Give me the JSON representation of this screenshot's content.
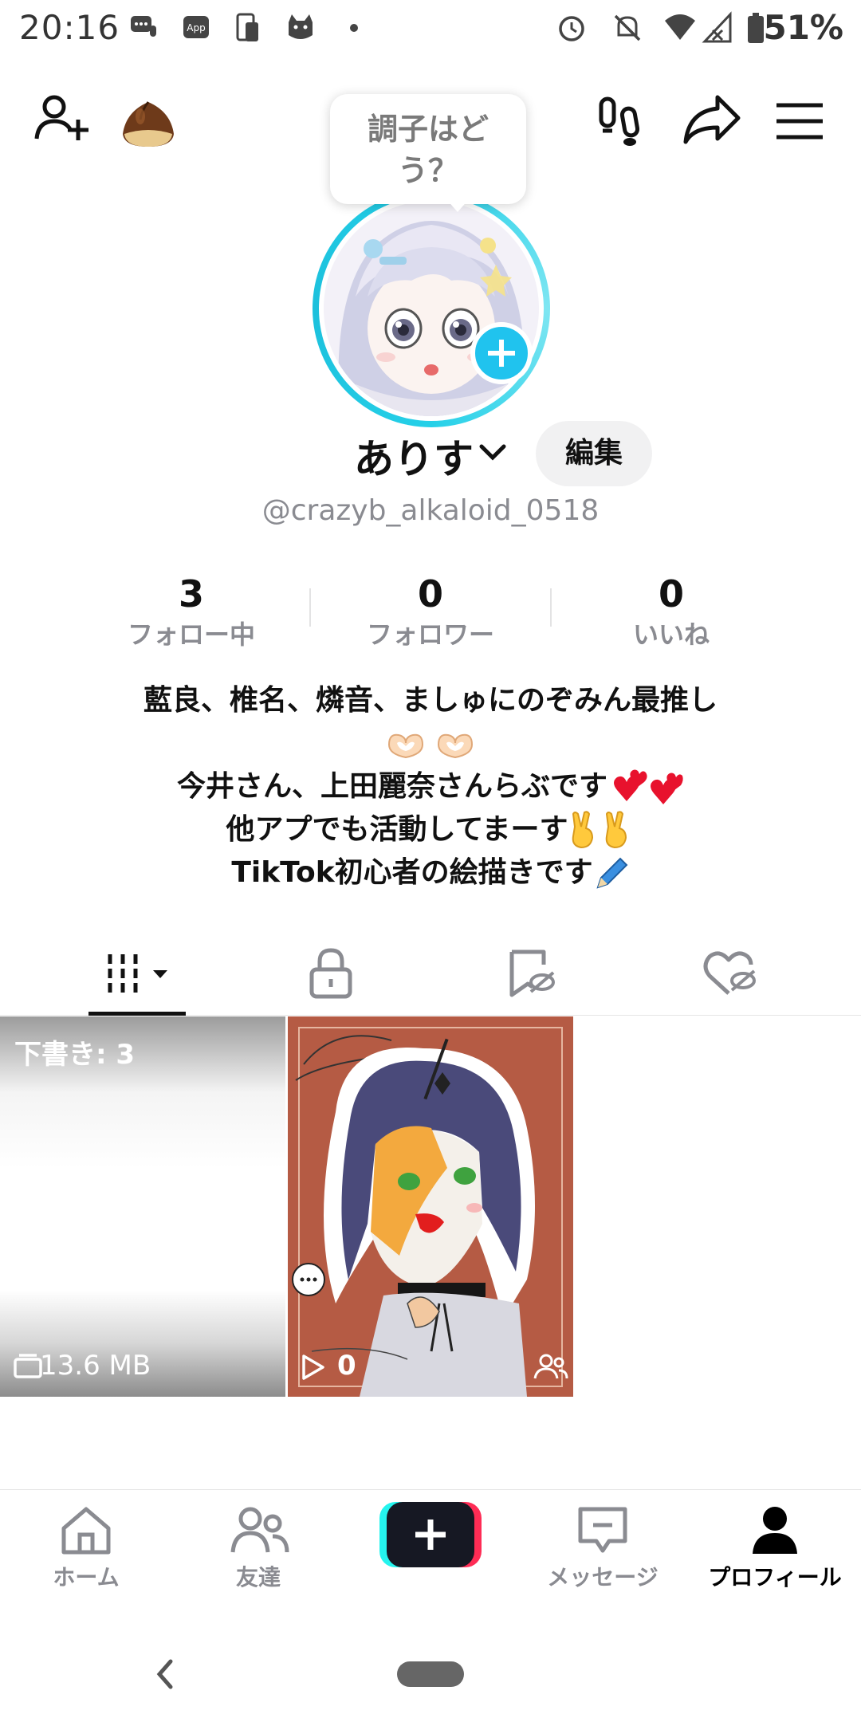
{
  "status_bar": {
    "time": "20:16",
    "battery": "51%",
    "icons_left": [
      "chat-bubble-icon",
      "app-icon",
      "phone-tablet-icon",
      "cat-icon",
      "dot-icon"
    ],
    "icons_right": [
      "alarm-icon",
      "mute-bell-icon",
      "wifi-icon",
      "signal-icon",
      "battery-icon"
    ]
  },
  "header": {
    "add_friend_icon": "person-add-icon",
    "chestnut_icon": "chestnut-icon",
    "footprints_icon": "footprints-icon",
    "share_icon": "share-arrow-icon",
    "menu_icon": "hamburger-menu-icon"
  },
  "bubble": {
    "text_line1": "調子はど",
    "text_line2": "う？"
  },
  "profile": {
    "username": "ありす",
    "edit_label": "編集",
    "handle": "@crazyb_alkaloid_0518"
  },
  "stats": [
    {
      "value": "3",
      "label": "フォロー中"
    },
    {
      "value": "0",
      "label": "フォロワー"
    },
    {
      "value": "0",
      "label": "いいね"
    }
  ],
  "bio": {
    "line1": "藍良、椎名、燐音、ましゅにのぞみん最推し",
    "line3": "今井さん、上田麗奈さんらぶです",
    "line4": "他アプでも活動してまーす",
    "line5": "TikTok初心者の絵描きです"
  },
  "tabs": [
    "grid-tab",
    "lock-tab",
    "bookmark-tab",
    "liked-tab"
  ],
  "grid": {
    "draft_label": "下書き: 3",
    "draft_size": "13.6 MB",
    "video_play_count": "0"
  },
  "bottom_nav": {
    "home": "ホーム",
    "friends": "友達",
    "inbox": "メッセージ",
    "profile": "プロフィール"
  },
  "colors": {
    "accent_cyan": "#20c3ee",
    "tiktok_red": "#fe2c55",
    "tiktok_cyan": "#25f4ee",
    "text_gray": "#8a8b91"
  }
}
